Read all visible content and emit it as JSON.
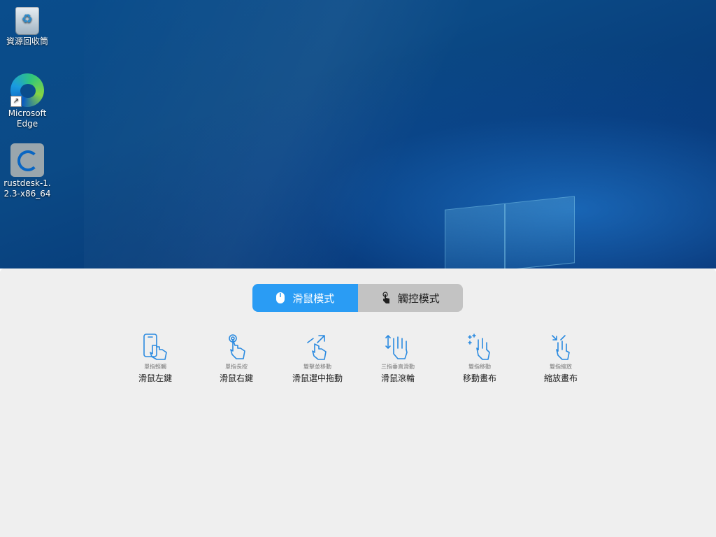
{
  "desktop": {
    "icons": [
      {
        "label": "資源回收筒",
        "icon": "recycle-bin-icon"
      },
      {
        "label": "Microsoft Edge",
        "icon": "edge-icon"
      },
      {
        "label": "rustdesk-1.2.3-x86_64",
        "icon": "rustdesk-icon"
      }
    ]
  },
  "panel": {
    "modes": [
      {
        "label": "滑鼠模式",
        "icon": "mouse-icon",
        "active": true
      },
      {
        "label": "觸控模式",
        "icon": "touch-icon",
        "active": false
      }
    ],
    "gestures": [
      {
        "hint": "單指輕觸",
        "action": "滑鼠左鍵",
        "icon": "single-tap-icon"
      },
      {
        "hint": "單指長按",
        "action": "滑鼠右鍵",
        "icon": "long-press-icon"
      },
      {
        "hint": "雙擊並移動",
        "action": "滑鼠選中拖動",
        "icon": "double-tap-drag-icon"
      },
      {
        "hint": "三指垂直滑動",
        "action": "滑鼠滾輪",
        "icon": "three-finger-scroll-icon"
      },
      {
        "hint": "雙指移動",
        "action": "移動畫布",
        "icon": "two-finger-pan-icon"
      },
      {
        "hint": "雙指縮放",
        "action": "縮放畫布",
        "icon": "pinch-zoom-icon"
      }
    ]
  },
  "colors": {
    "accent": "#2a9cf4",
    "inactive": "#c3c3c3",
    "panel_bg": "#efefef"
  }
}
